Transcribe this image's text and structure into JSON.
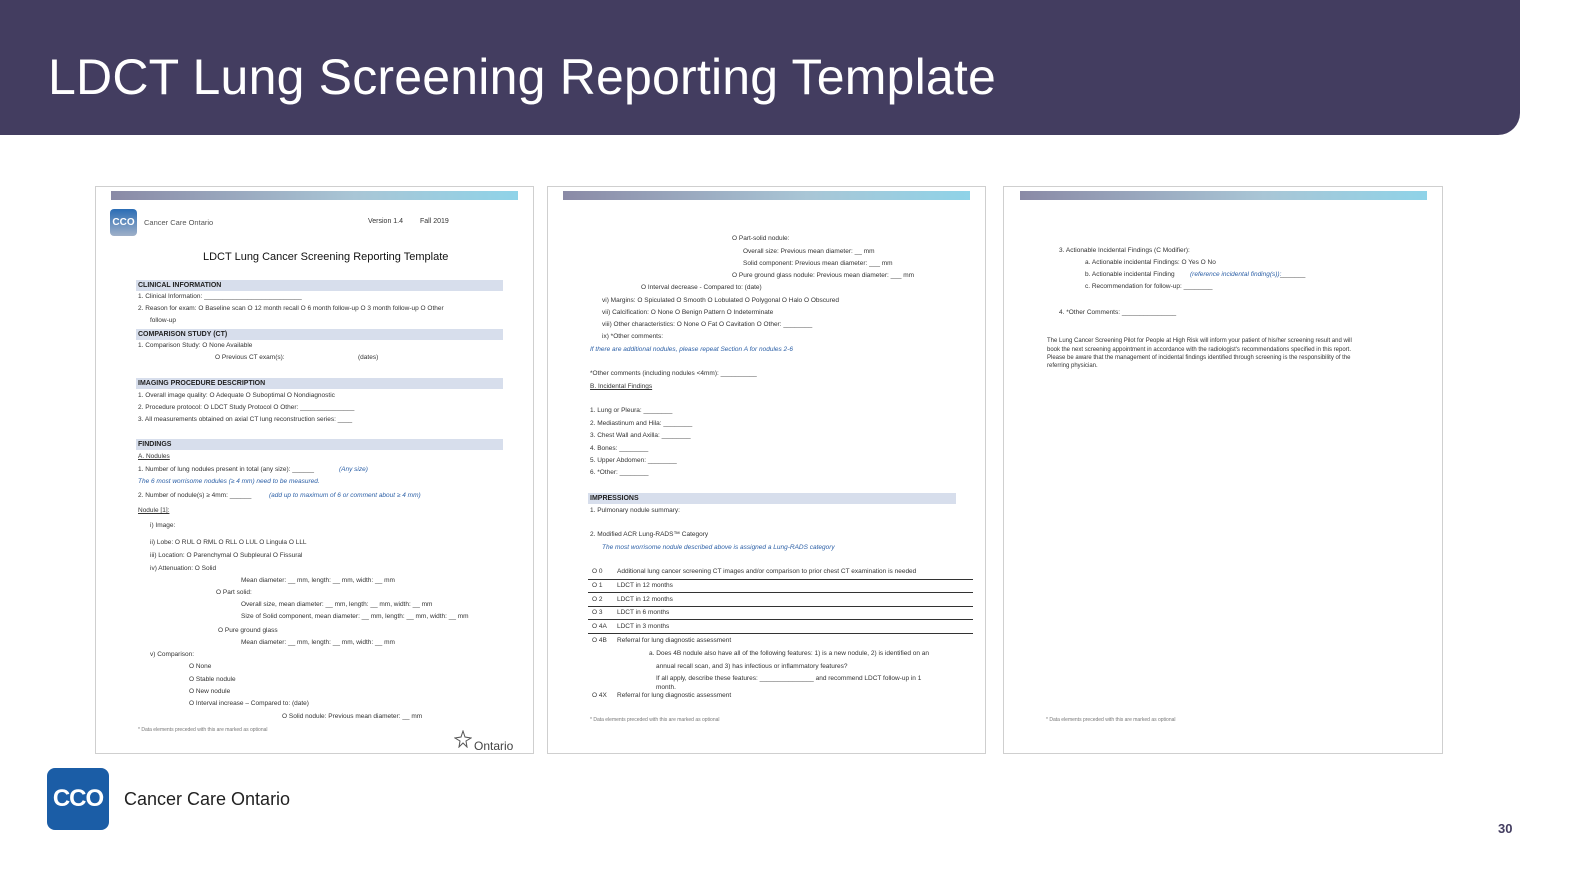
{
  "slide": {
    "title": "LDCT Lung Screening Reporting Template",
    "page_number": "30",
    "brand_color": "#433d60"
  },
  "footer": {
    "logo_text": "CCO",
    "org_name": "Cancer Care Ontario"
  },
  "doc1": {
    "logo_text": "CCO",
    "org_name": "Cancer Care Ontario",
    "version": "Version 1.4",
    "date": "Fall 2019",
    "title": "LDCT Lung Cancer Screening Reporting Template",
    "clinical_header": "CLINICAL INFORMATION",
    "clinical_1": "1.  Clinical Information: ___________________________",
    "clinical_2": "2.  Reason for exam: O Baseline scan  O 12 month recall  O 6 month follow-up  O 3 month follow-up O Other",
    "clinical_2b": "follow-up",
    "comparison_header": "COMPARISON STUDY (CT)",
    "comparison_1": "1.  Comparison Study: O None Available",
    "comparison_1b": "O Previous CT exam(s):",
    "comparison_1c": "(dates)",
    "imaging_header": "IMAGING PROCEDURE DESCRIPTION",
    "imaging_1": "1. Overall image quality: O Adequate   O Suboptimal   O Nondiagnostic",
    "imaging_2": "2. Procedure protocol: O LDCT Study Protocol   O Other: _______________",
    "imaging_3": "3. All measurements obtained on axial CT lung reconstruction series: ____",
    "findings_header": "FINDINGS",
    "nodules_heading": "A.  Nodules",
    "nod_1": "1.  Number of lung nodules present in total (any size): ______",
    "nod_1_note": "(Any size)",
    "nod_note": "The 6 most worrisome nodules (≥ 4 mm) need to be measured.",
    "nod_2": "2.  Number of nodule(s) ≥ 4mm: ______",
    "nod_2_note": "(add up to maximum of 6 or comment about ≥ 4 mm)",
    "nodule_label": "Nodule [1]:",
    "item_i": "i)         Image:",
    "item_ii": "ii)        Lobe: O RUL  O RML  O RLL  O LUL  O Lingula  O LLL",
    "item_iii": "iii)       Location: O Parenchymal  O Subpleural   O Fissural",
    "item_iv": "iv)       Attenuation: O Solid",
    "iv_mean": "Mean diameter: __ mm, length: __ mm, width: __ mm",
    "iv_part": "O Part solid:",
    "iv_part_a": "Overall size, mean diameter: __ mm, length: __ mm, width: __ mm",
    "iv_part_b": "Size of Solid component, mean diameter: __ mm, length: __ mm, width: __ mm",
    "iv_ggn": "O Pure ground glass",
    "iv_ggn_mean": "Mean diameter: __ mm, length: __ mm, width: __ mm",
    "item_v": "v)        Comparison:",
    "v_none": "O None",
    "v_stable": "O Stable nodule",
    "v_new": "O New nodule",
    "v_interval": "O Interval increase – Compared to:          (date)",
    "v_solid": "O Solid nodule: Previous mean diameter: __ mm",
    "foot_note": "* Data elements preceded with this are marked as optional",
    "ontario": "Ontario"
  },
  "doc2": {
    "l1": "O Part-solid nodule:",
    "l2": "Overall size: Previous mean diameter: __ mm",
    "l3": "Solid component: Previous mean diameter: ___ mm",
    "l4": "O Pure ground glass nodule: Previous mean diameter: ___ mm",
    "l5": "O Interval decrease - Compared to:          (date)",
    "vi": "vi)       Margins: O Spiculated  O Smooth  O Lobulated  O Polygonal  O Halo  O Obscured",
    "vii": "vii)      Calcification: O None  O Benign Pattern  O Indeterminate",
    "viii": "viii)     Other characteristics: O None     O Fat     O Cavitation     O Other: ________",
    "ix": "ix)       *Other comments:",
    "repeat_note": "If there are additional nodules, please repeat Section A for nodules 2-6",
    "other_comments": "*Other comments (including nodules <4mm): __________",
    "incidental_heading": "B.  Incidental Findings",
    "inc_1": "1.  Lung or Pleura: ________",
    "inc_2": "2.  Mediastinum and Hila: ________",
    "inc_3": "3.  Chest Wall and Axilla: ________",
    "inc_4": "4.  Bones: ________",
    "inc_5": "5.  Upper Abdomen: ________",
    "inc_6": "6.  *Other: ________",
    "impressions_header": "IMPRESSIONS",
    "imp_1": "1.  Pulmonary nodule summary:",
    "imp_2": "2.  Modified ACR Lung-RADS™ Category",
    "imp_2_note": "The most worrisome nodule described above is assigned a Lung-RADS category",
    "cat_0_code": "O 0",
    "cat_0": "Additional lung cancer screening CT images and/or comparison to prior chest CT examination is needed",
    "cat_1_code": "O 1",
    "cat_1": "LDCT in 12 months",
    "cat_2_code": "O 2",
    "cat_2": "LDCT in 12 months",
    "cat_3_code": "O 3",
    "cat_3": "LDCT in 6 months",
    "cat_4a_code": "O 4A",
    "cat_4a": "LDCT in 3 months",
    "cat_4b_code": "O 4B",
    "cat_4b": "Referral for lung diagnostic assessment",
    "cat_4b_a": "a.   Does 4B nodule also have all of the following features: 1) is a new nodule, 2) is identified on an",
    "cat_4b_b": "annual recall scan, and 3) has infectious or inflammatory features?",
    "cat_4b_c": "If all apply, describe these features: _______________ and recommend LDCT follow-up in 1",
    "cat_4b_d": "month.",
    "cat_4x_code": "O 4X",
    "cat_4x": "Referral for lung diagnostic assessment",
    "foot_note": "* Data elements preceded with this are marked as optional"
  },
  "doc3": {
    "l1": "3.  Actionable Incidental Findings (C Modifier):",
    "l2": "a.   Actionable incidental Findings: O Yes O No",
    "l3": "b.   Actionable incidental Finding",
    "l3_note": "(reference incidental finding(s)):",
    "l3_tail": "_______",
    "l4": "c.   Recommendation for follow-up: ________",
    "l5": "4.  *Other Comments: _______________",
    "p1": "The Lung Cancer Screening Pilot for People at High Risk will inform your patient of his/her screening result and will",
    "p2": "book the next screening appointment in accordance with the radiologist's recommendations specified in this report.",
    "p3": "Please be aware that the management of incidental findings identified through screening is the responsibility of the",
    "p4": "referring physician.",
    "foot_note": "* Data elements preceded with this are marked as optional"
  }
}
